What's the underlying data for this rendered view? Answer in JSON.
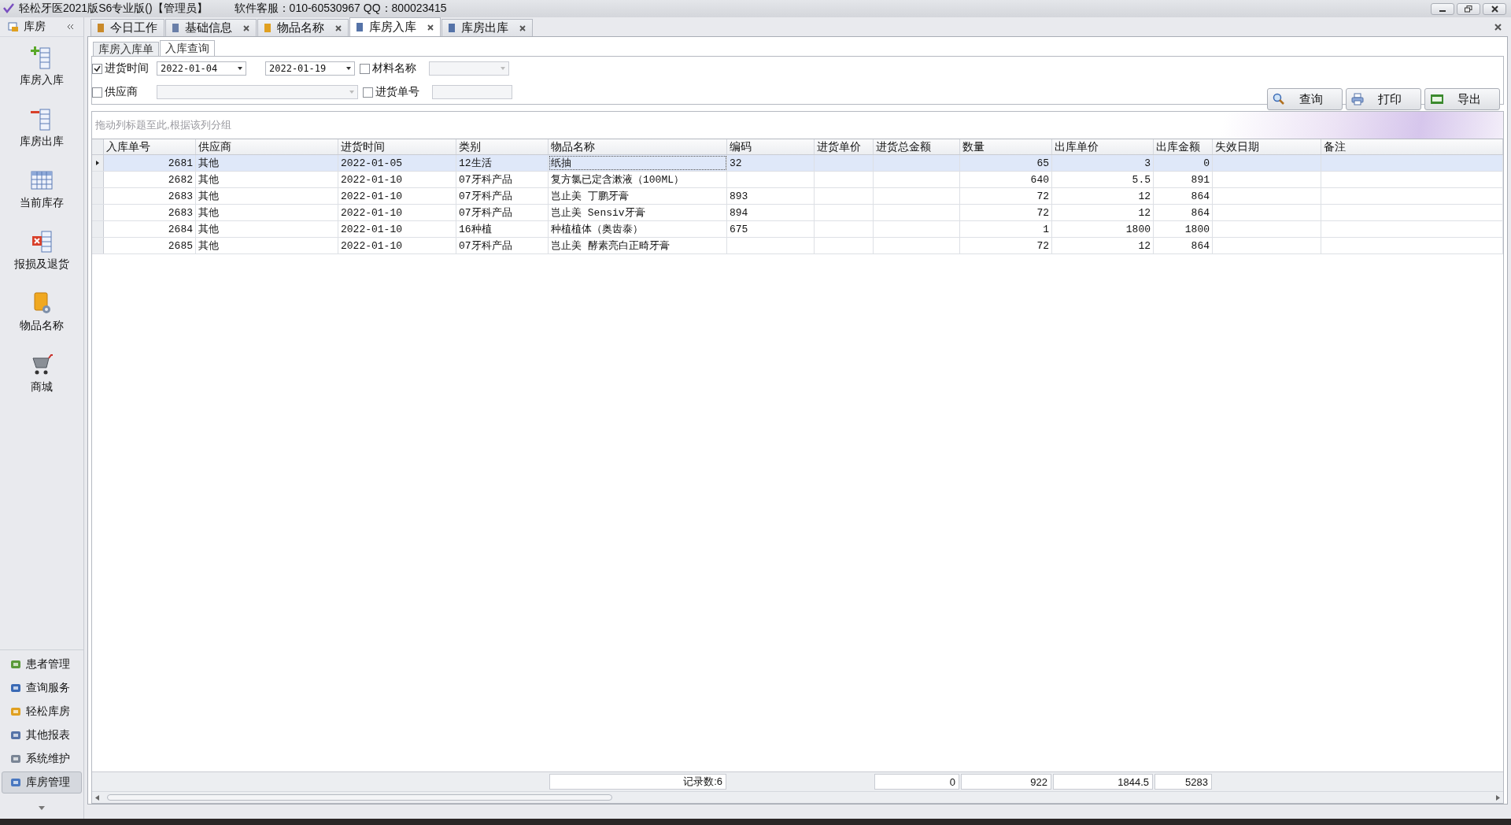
{
  "window": {
    "title": "轻松牙医2021版S6专业版()【管理员】",
    "support": "软件客服：010-60530967 QQ：800023415"
  },
  "sidebar": {
    "header": "库房",
    "items": [
      {
        "label": "库房入库"
      },
      {
        "label": "库房出库"
      },
      {
        "label": "当前库存"
      },
      {
        "label": "报损及退货"
      },
      {
        "label": "物品名称"
      },
      {
        "label": "商城"
      }
    ],
    "nav": [
      {
        "label": "患者管理",
        "selected": false
      },
      {
        "label": "查询服务",
        "selected": false
      },
      {
        "label": "轻松库房",
        "selected": false
      },
      {
        "label": "其他报表",
        "selected": false
      },
      {
        "label": "系统维护",
        "selected": false
      },
      {
        "label": "库房管理",
        "selected": true
      }
    ]
  },
  "tabs": [
    {
      "label": "今日工作",
      "selected": false,
      "closable": false
    },
    {
      "label": "基础信息",
      "selected": false,
      "closable": true
    },
    {
      "label": "物品名称",
      "selected": false,
      "closable": true
    },
    {
      "label": "库房入库",
      "selected": true,
      "closable": true
    },
    {
      "label": "库房出库",
      "selected": false,
      "closable": true
    }
  ],
  "subtabs": [
    {
      "label": "库房入库单",
      "selected": false
    },
    {
      "label": "入库查询",
      "selected": true
    }
  ],
  "filters": {
    "date": {
      "label": "进货时间",
      "checked": true,
      "from": "2022-01-04",
      "to": "2022-01-19"
    },
    "material": {
      "label": "材料名称",
      "checked": false
    },
    "supplier": {
      "label": "供应商",
      "checked": false
    },
    "order_no": {
      "label": "进货单号",
      "checked": false
    }
  },
  "buttons": [
    {
      "label": "查询"
    },
    {
      "label": "打印"
    },
    {
      "label": "导出"
    }
  ],
  "group_hint": "拖动列标题至此,根据该列分组",
  "table": {
    "columns": [
      {
        "label": "入库单号",
        "kind": "number"
      },
      {
        "label": "供应商",
        "kind": "text"
      },
      {
        "label": "进货时间",
        "kind": "text"
      },
      {
        "label": "类别",
        "kind": "text"
      },
      {
        "label": "物品名称",
        "kind": "text",
        "total": "记录数:6"
      },
      {
        "label": "编码",
        "kind": "text"
      },
      {
        "label": "进货单价"
      },
      {
        "label": "进货总金额",
        "total": "0"
      },
      {
        "label": "数量",
        "kind": "number",
        "total": "922"
      },
      {
        "label": "出库单价",
        "kind": "number",
        "total": "1844.5"
      },
      {
        "label": "出库金额",
        "kind": "number",
        "total": "5283"
      },
      {
        "label": "失效日期"
      },
      {
        "label": "备注"
      }
    ],
    "rows": [
      {
        "selected": true,
        "cells": [
          "2681",
          "其他",
          "2022-01-05",
          "12生活",
          "纸抽",
          "32",
          null,
          null,
          "65",
          "3",
          "0",
          null,
          null
        ]
      },
      {
        "selected": false,
        "cells": [
          "2682",
          "其他",
          "2022-01-10",
          "07牙科产品",
          "复方氯已定含漱液（100ML）",
          null,
          null,
          null,
          "640",
          "5.5",
          "891",
          null,
          null
        ]
      },
      {
        "selected": false,
        "cells": [
          "2683",
          "其他",
          "2022-01-10",
          "07牙科产品",
          "岂止美 丁鹏牙膏",
          "893",
          null,
          null,
          "72",
          "12",
          "864",
          null,
          null
        ]
      },
      {
        "selected": false,
        "cells": [
          "2683",
          "其他",
          "2022-01-10",
          "07牙科产品",
          "岂止美 Sensiv牙膏",
          "894",
          null,
          null,
          "72",
          "12",
          "864",
          null,
          null
        ]
      },
      {
        "selected": false,
        "cells": [
          "2684",
          "其他",
          "2022-01-10",
          "16种植",
          "种植植体（奥齿泰）",
          "675",
          null,
          null,
          "1",
          "1800",
          "1800",
          null,
          null
        ]
      },
      {
        "selected": false,
        "cells": [
          "2685",
          "其他",
          "2022-01-10",
          "07牙科产品",
          "岂止美 酵素亮白正畸牙膏",
          null,
          null,
          null,
          "72",
          "12",
          "864",
          null,
          null
        ]
      }
    ]
  }
}
